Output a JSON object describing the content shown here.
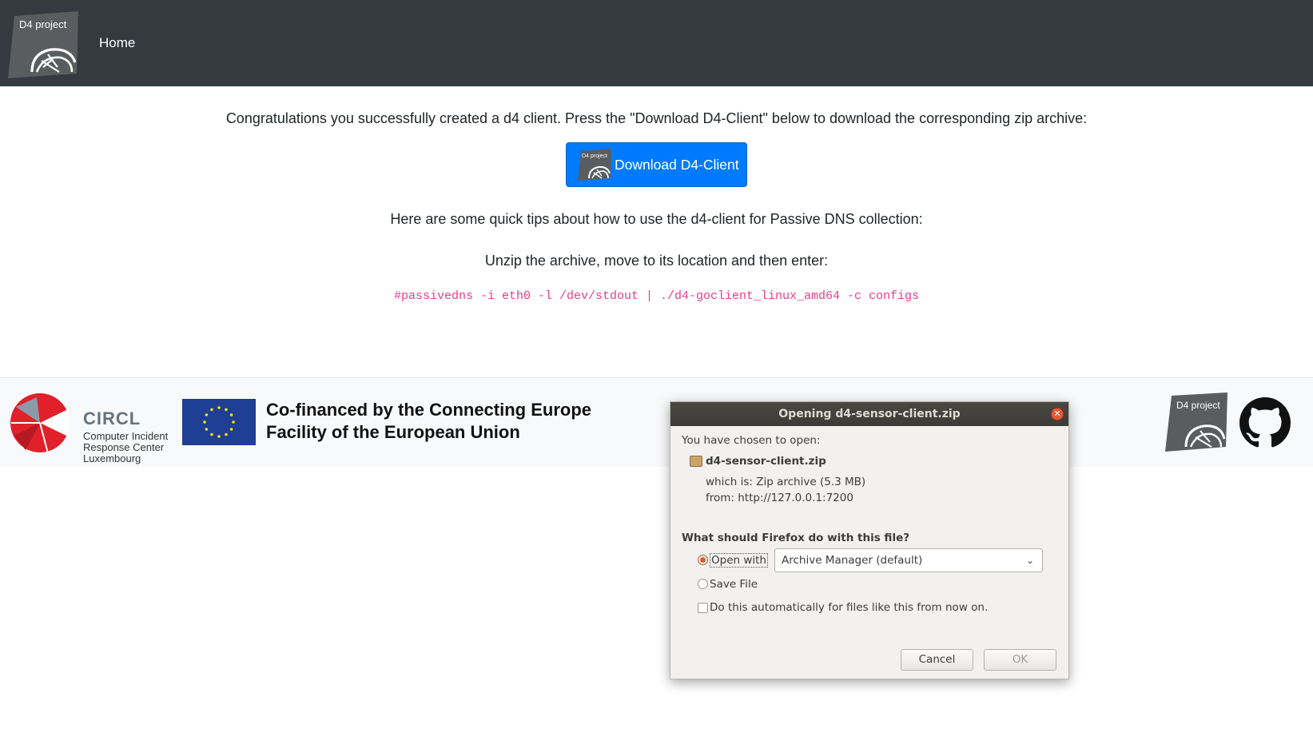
{
  "navbar": {
    "logo_text": "D4 project",
    "home_label": "Home"
  },
  "main": {
    "intro": "Congratulations you successfully created a d4 client. Press the \"Download D4-Client\" below to download the corresponding zip archive:",
    "download_button": "Download D4-Client",
    "download_logo_text": "D4 project",
    "tips": "Here are some quick tips about how to use the d4-client for Passive DNS collection:",
    "unzip": "Unzip the archive, move to its location and then enter:",
    "command": "#passivedns -i eth0 -l /dev/stdout | ./d4-goclient_linux_amd64 -c configs"
  },
  "footer": {
    "circl_name": "CIRCL",
    "circl_sub_1": "Computer Incident",
    "circl_sub_2": "Response Center",
    "circl_sub_3": "Luxembourg",
    "eu_line_1": "Co-financed by the Connecting Europe",
    "eu_line_2": "Facility of the European Union",
    "d4_logo_text": "D4 project"
  },
  "dialog": {
    "title": "Opening d4-sensor-client.zip",
    "chosen_label": "You have chosen to open:",
    "filename": "d4-sensor-client.zip",
    "which_is": "which is:  Zip archive (5.3 MB)",
    "from": "from:  http://127.0.0.1:7200",
    "question": "What should Firefox do with this file?",
    "open_with_label": "Open with",
    "open_with_value": "Archive Manager (default)",
    "save_file_label": "Save File",
    "auto_label": "Do this automatically for files like this from now on.",
    "cancel_label": "Cancel",
    "ok_label": "OK",
    "selected_option": "open_with"
  },
  "colors": {
    "navbar_bg": "#343a40",
    "button_primary": "#007bff",
    "command_text": "#e83e8c",
    "circl_red": "#e0202a",
    "eu_blue": "#1f3f94",
    "eu_star": "#ffdd00"
  }
}
